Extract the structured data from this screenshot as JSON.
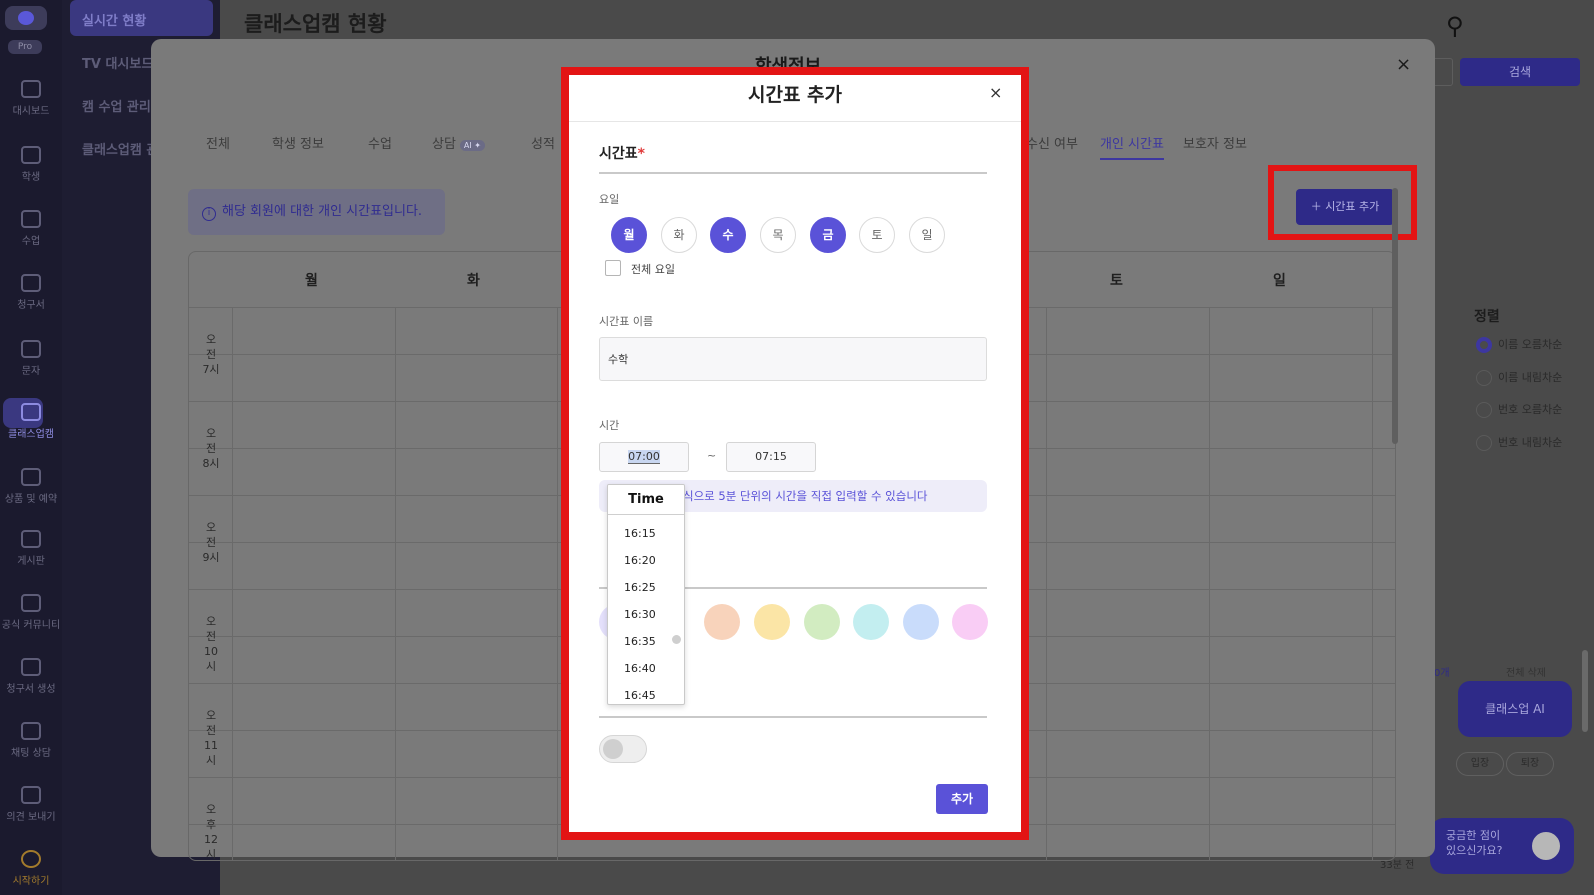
{
  "sidebar": {
    "pro": "Pro",
    "items": [
      {
        "label": "대시보드",
        "icon": "dashboard-icon"
      },
      {
        "label": "학생",
        "icon": "student-icon"
      },
      {
        "label": "수업",
        "icon": "calendar-icon"
      },
      {
        "label": "청구서",
        "icon": "won-icon"
      },
      {
        "label": "문자",
        "icon": "mail-icon"
      },
      {
        "label": "클래스업캠",
        "icon": "cam-icon"
      },
      {
        "label": "상품 및 예약",
        "icon": "bag-icon"
      },
      {
        "label": "게시판",
        "icon": "board-icon"
      },
      {
        "label": "공식 커뮤니티",
        "icon": "community-icon"
      },
      {
        "label": "청구서 생성",
        "icon": "bolt-icon"
      },
      {
        "label": "채팅 상담",
        "icon": "chat-icon"
      },
      {
        "label": "의견 보내기",
        "icon": "feedback-icon"
      },
      {
        "label": "시작하기",
        "icon": "start-icon"
      }
    ]
  },
  "subnav": {
    "items": [
      "실시간 현황",
      "TV 대시보드",
      "캠 수업 관리",
      "클래스업캠 관"
    ]
  },
  "page": {
    "title": "클래스업캠 현황"
  },
  "student_modal": {
    "title": "학생정보",
    "close": "×",
    "tabs": [
      "전체",
      "학생 정보",
      "수업",
      "상담",
      "성적",
      "수신 여부",
      "개인 시간표",
      "보호자 정보"
    ],
    "ai_badge": "AI ✦",
    "info": "해당 회원에 대한 개인 시간표입니다.",
    "add_button": "시간표 추가",
    "calendar": {
      "days": [
        "월",
        "화",
        "토",
        "일"
      ],
      "times": [
        [
          "오전",
          "7시"
        ],
        [
          "오전",
          "8시"
        ],
        [
          "오전",
          "9시"
        ],
        [
          "오전",
          "10시"
        ],
        [
          "오전",
          "11시"
        ],
        [
          "오후",
          "12시"
        ]
      ]
    }
  },
  "right_panel": {
    "search_button": "검색",
    "sort_title": "정렬",
    "sort_options": [
      "이름 오름차순",
      "이름 내림차순",
      "번호 오름차순",
      "번호 내림차순"
    ],
    "count_label": "0개",
    "delete_all": "전체 삭제",
    "enter": "입장",
    "leave": "퇴장",
    "ai_button": "클래스업 AI",
    "help_line1": "궁금한 점이",
    "help_line2": "있으신가요?",
    "time_ago": "33분 전"
  },
  "add_modal": {
    "title": "시간표 추가",
    "close": "×",
    "section_title": "시간표",
    "required": "*",
    "weekday_label": "요일",
    "days": [
      "월",
      "화",
      "수",
      "목",
      "금",
      "토",
      "일"
    ],
    "selected_days": [
      "월",
      "수",
      "금"
    ],
    "all_days_label": "전체 요일",
    "name_label": "시간표 이름",
    "name_value": "수학",
    "time_label": "시간",
    "start_time": "07:00",
    "end_time": "07:15",
    "tilde": "~",
    "hint": "식으로 5분 단위의 시간을 직접 입력할 수 있습니다",
    "colors": [
      "#f8d3bb",
      "#fbe5a6",
      "#d2ecc1",
      "#c3eef0",
      "#c9dcfb",
      "#f9cdf5"
    ],
    "submit": "추가"
  },
  "time_dropdown": {
    "header": "Time",
    "options": [
      "16:15",
      "16:20",
      "16:25",
      "16:30",
      "16:35",
      "16:40",
      "16:45"
    ]
  }
}
